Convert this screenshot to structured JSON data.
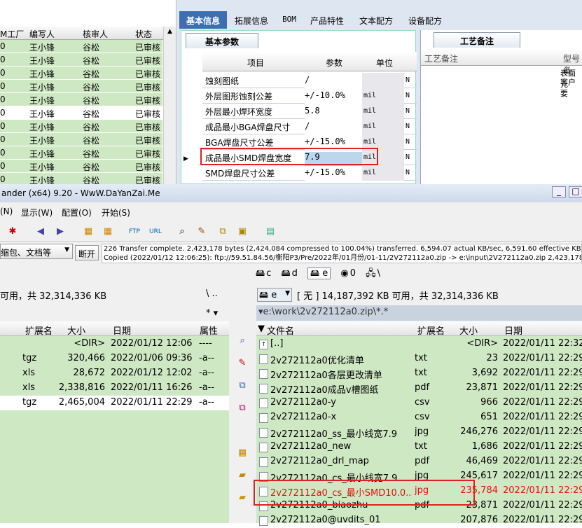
{
  "left_grid": {
    "headers": [
      "M工厂",
      "编写人",
      "核审人",
      "状态"
    ],
    "rows": [
      [
        "0",
        "王小锋",
        "谷松",
        "已审核"
      ],
      [
        "0",
        "王小锋",
        "谷松",
        "已审核"
      ],
      [
        "0",
        "王小锋",
        "谷松",
        "已审核"
      ],
      [
        "0",
        "王小锋",
        "谷松",
        "已审核"
      ],
      [
        "0",
        "王小锋",
        "谷松",
        "已审核"
      ],
      [
        "0",
        "王小锋",
        "谷松",
        "已审核"
      ],
      [
        "0",
        "王小锋",
        "谷松",
        "已审核"
      ],
      [
        "0",
        "王小锋",
        "谷松",
        "已审核"
      ],
      [
        "0",
        "王小锋",
        "谷松",
        "已审核"
      ],
      [
        "0",
        "王小锋",
        "谷松",
        "已审核"
      ],
      [
        "0",
        "王小锋",
        "谷松",
        "已审核"
      ]
    ]
  },
  "tabs": [
    "基本信息",
    "拓展信息",
    "BOM",
    "产品特性",
    "文本配方",
    "设备配方"
  ],
  "params": {
    "tab": "基本参数",
    "headers": [
      "项目",
      "参数",
      "单位"
    ],
    "rows": [
      [
        "蚀刻图纸",
        "/",
        "",
        "N"
      ],
      [
        "外层图形蚀刻公差",
        "+/-10.0%",
        "mil",
        "N"
      ],
      [
        "外层最小焊环宽度",
        "5.8",
        "mil",
        "N"
      ],
      [
        "成品最小BGA焊盘尺寸",
        "/",
        "mil",
        "N"
      ],
      [
        "BGA焊盘尺寸公差",
        "+/-15.0%",
        "mil",
        "N"
      ],
      [
        "成品最小SMD焊盘宽度",
        "7.9",
        "mil",
        "N"
      ],
      [
        "SMD焊盘尺寸公差",
        "+/-15.0%",
        "mil",
        "N"
      ]
    ]
  },
  "notes": {
    "tab": "工艺备注",
    "col1": "工艺备注",
    "col2": "型号备",
    "val1": "表面元",
    "val2": "客户要"
  },
  "tc": {
    "title": "ander (x64) 9.20 - WwW.DaYanZai.Me",
    "menu": [
      "(N)",
      "显示(W)",
      "配置(O)",
      "开始(S)"
    ],
    "log1": "226 Transfer complete. 2,423,178 bytes (2,424,084 compressed to 100.04%) transferred. 6,594.07 actual KB/sec, 6,591.60 effective KB/sec.",
    "log2": "Copied (2022/01/12 12:06:25): ftp://59.51.84.56/衡阳P3/Pre/2022年/01月份/01-11/2V272112a0.zip -> e:\\input\\2V272112a0.zip 2,423,178 b",
    "pack_btn": "缩包、文档等",
    "disconnect": "断开",
    "drives": [
      "c",
      "d",
      "e",
      "0",
      "\\"
    ],
    "left_space": "可用，共 32,314,336 KB",
    "left_path_tail": "\\  ..",
    "left_filter": "*  ▾",
    "right_drive": "e",
    "right_space": "[ 无 ]  14,187,392 KB 可用，共 32,314,336 KB",
    "right_path": "e:\\work\\2v272112a0.zip\\*.*",
    "left_headers": [
      "扩展名",
      "大小",
      "日期",
      "属性"
    ],
    "left_files": [
      [
        "",
        "<DIR>",
        "2022/01/12 12:06",
        "----"
      ],
      [
        "tgz",
        "320,466",
        "2022/01/06 09:36",
        "-a--"
      ],
      [
        "xls",
        "28,672",
        "2022/01/12 12:02",
        "-a--"
      ],
      [
        "xls",
        "2,338,816",
        "2022/01/11 16:26",
        "-a--"
      ],
      [
        "tgz",
        "2,465,004",
        "2022/01/11 22:29",
        "-a--"
      ]
    ],
    "right_headers": [
      "文件名",
      "扩展名",
      "大小",
      "日期"
    ],
    "right_files": [
      [
        "[..]",
        "",
        "<DIR>",
        "2022/01/11 22:32"
      ],
      [
        "2v272112a0优化清单",
        "txt",
        "23",
        "2022/01/11 22:29"
      ],
      [
        "2v272112a0各层更改清单",
        "txt",
        "3,692",
        "2022/01/11 22:29"
      ],
      [
        "2v272112a0成品v槽图纸",
        "pdf",
        "23,871",
        "2022/01/11 22:29"
      ],
      [
        "2v272112a0-y",
        "csv",
        "966",
        "2022/01/11 22:29"
      ],
      [
        "2v272112a0-x",
        "csv",
        "651",
        "2022/01/11 22:29"
      ],
      [
        "2v272112a0_ss_最小线宽7.9",
        "jpg",
        "246,276",
        "2022/01/11 22:29"
      ],
      [
        "2v272112a0_new",
        "txt",
        "1,686",
        "2022/01/11 22:29"
      ],
      [
        "2v272112a0_drl_map",
        "pdf",
        "46,469",
        "2022/01/11 22:29"
      ],
      [
        "2v272112a0_cs_最小线宽7.9",
        "jpg",
        "245,617",
        "2022/01/11 22:29"
      ],
      [
        "2v272112a0_cs_最小SMD10.0..",
        "jpg",
        "235,784",
        "2022/01/11 22:29"
      ],
      [
        "2v272112a0_biaozhu",
        "pdf",
        "23,871",
        "2022/01/11 22:29"
      ],
      [
        "2v272112a0@uvdits_01",
        "",
        "207,876",
        "2022/01/11 22:29"
      ]
    ]
  }
}
